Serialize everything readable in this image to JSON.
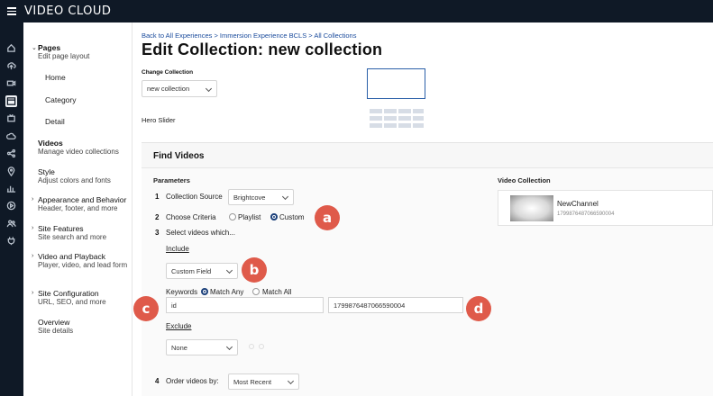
{
  "app": {
    "brand": "VIDEO CLOUD"
  },
  "rail": {
    "icons": [
      "home-icon",
      "upload-icon",
      "video-icon",
      "experiences-icon",
      "live-icon",
      "cloud-icon",
      "share-icon",
      "location-icon",
      "analytics-icon",
      "play-icon",
      "users-icon",
      "plugin-icon"
    ]
  },
  "sidebar": {
    "pages": {
      "title": "Pages",
      "sub": "Edit page layout",
      "children": [
        "Home",
        "Category",
        "Detail"
      ]
    },
    "videos": {
      "title": "Videos",
      "sub": "Manage video collections"
    },
    "style": {
      "title": "Style",
      "sub": "Adjust colors and fonts"
    },
    "appearance": {
      "title": "Appearance and Behavior",
      "sub": "Header, footer, and more"
    },
    "site_features": {
      "title": "Site Features",
      "sub": "Site search and more"
    },
    "video_playback": {
      "title": "Video and Playback",
      "sub": "Player, video, and lead form"
    },
    "site_config": {
      "title": "Site Configuration",
      "sub": "URL, SEO, and more"
    },
    "overview": {
      "title": "Overview",
      "sub": "Site details"
    }
  },
  "header": {
    "breadcrumb": "Back to All Experiences > Immersion Experience BCLS > All Collections",
    "title": "Edit Collection: new collection"
  },
  "change_collection": {
    "label": "Change Collection",
    "value": "new collection"
  },
  "hero_slider": {
    "label": "Hero Slider"
  },
  "find_videos": {
    "title": "Find Videos",
    "parameters_label": "Parameters",
    "step1": {
      "num": "1",
      "label": "Collection Source",
      "value": "Brightcove"
    },
    "step2": {
      "num": "2",
      "label": "Choose Criteria",
      "option_playlist": "Playlist",
      "option_custom": "Custom",
      "selected": "Custom"
    },
    "step3": {
      "num": "3",
      "label": "Select videos which..."
    },
    "include_label": "Include",
    "include_select": "Custom Field",
    "keywords_label": "Keywords",
    "match_any": "Match Any",
    "match_all": "Match All",
    "match_selected": "Match Any",
    "field_name": "id",
    "field_value": "1799876487066590004",
    "exclude_label": "Exclude",
    "exclude_select": "None",
    "step4": {
      "num": "4",
      "label": "Order videos by:",
      "value": "Most Recent"
    }
  },
  "video_collection": {
    "title": "Video Collection",
    "item_name": "NewChannel",
    "item_id": "1799876487066590004"
  },
  "annotations": {
    "a": "a",
    "b": "b",
    "c": "c",
    "d": "d"
  }
}
